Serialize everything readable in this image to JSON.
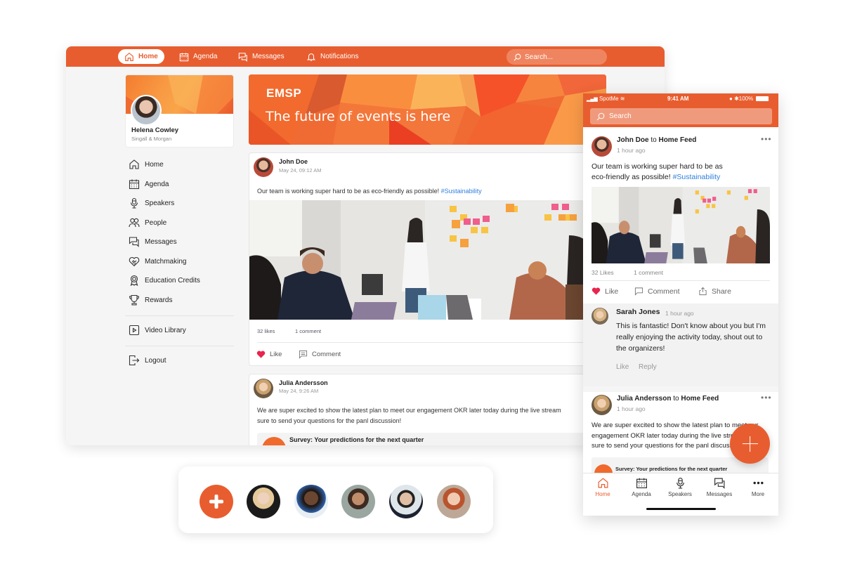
{
  "desktop": {
    "nav": {
      "home": "Home",
      "agenda": "Agenda",
      "messages": "Messages",
      "notifications": "Notifications",
      "search_placeholder": "Search..."
    },
    "profile": {
      "name": "Helena Cowley",
      "org": "Singall & Morgan"
    },
    "sidebar": {
      "items": [
        {
          "label": "Home",
          "icon": "home-icon"
        },
        {
          "label": "Agenda",
          "icon": "calendar-icon"
        },
        {
          "label": "Speakers",
          "icon": "microphone-icon"
        },
        {
          "label": "People",
          "icon": "people-icon"
        },
        {
          "label": "Messages",
          "icon": "messages-icon"
        },
        {
          "label": "Matchmaking",
          "icon": "handshake-heart-icon"
        },
        {
          "label": "Education Credits",
          "icon": "award-ribbon-icon"
        },
        {
          "label": "Rewards",
          "icon": "trophy-icon"
        }
      ],
      "video_library": "Video Library",
      "logout": "Logout"
    },
    "hero": {
      "logo": "EMSP",
      "title": "The future of events is here"
    },
    "posts": [
      {
        "author": "John Doe",
        "time": "May 24, 09:12 AM",
        "text": "Our team is working super hard to be as eco-friendly as possible! ",
        "hashtag": "#Sustainability",
        "likes": "32 likes",
        "comments": "1 comment",
        "like_label": "Like",
        "comment_label": "Comment"
      },
      {
        "author": "Julia Andersson",
        "time": "May 24, 9:26 AM",
        "text_line1": "We are super excited to show the latest plan to meet our engagement OKR later today during the live stream",
        "text_line2": "sure to send your questions for the panl discussion!",
        "survey_title": "Survey: Your predictions for the next quarter"
      }
    ]
  },
  "mobile": {
    "status": {
      "carrier": "SpotMe",
      "time": "9:41 AM",
      "battery": "100%"
    },
    "search_placeholder": "Search",
    "post1": {
      "author": "John Doe",
      "to": "to",
      "feed": "Home Feed",
      "time": "1 hour ago",
      "text_line1": "Our team is working super hard to be as",
      "text_line2": "eco-friendly as possible! ",
      "hashtag": "#Sustainability",
      "likes": "32 Likes",
      "comments": "1 comment",
      "like_label": "Like",
      "comment_label": "Comment",
      "share_label": "Share"
    },
    "comment": {
      "author": "Sarah Jones",
      "time": "1 hour ago",
      "line1": "This is fantastic! Don't know about you but I'm",
      "line2": "really enjoying the activity today, shout out to",
      "line3": "the organizers!",
      "like_label": "Like",
      "reply_label": "Reply"
    },
    "post2": {
      "author": "Julia Andersson",
      "to": "to",
      "feed": "Home Feed",
      "time": "1 hour ago",
      "line1": "We are super excited to show the latest plan to meet our",
      "line2": "engagement OKR later today during the live stream",
      "line3": "sure to send your questions for the panl discussion!",
      "survey_title": "Survey: Your predictions for the next quarter"
    },
    "tabs": [
      "Home",
      "Agenda",
      "Speakers",
      "Messages",
      "More"
    ]
  },
  "avatar_bar": {
    "people": [
      "attendee-1",
      "attendee-2",
      "attendee-3",
      "attendee-4",
      "attendee-5"
    ]
  },
  "colors": {
    "brand": "#e85d2f",
    "hashtag": "#2f7fe0",
    "like": "#e8254d"
  }
}
